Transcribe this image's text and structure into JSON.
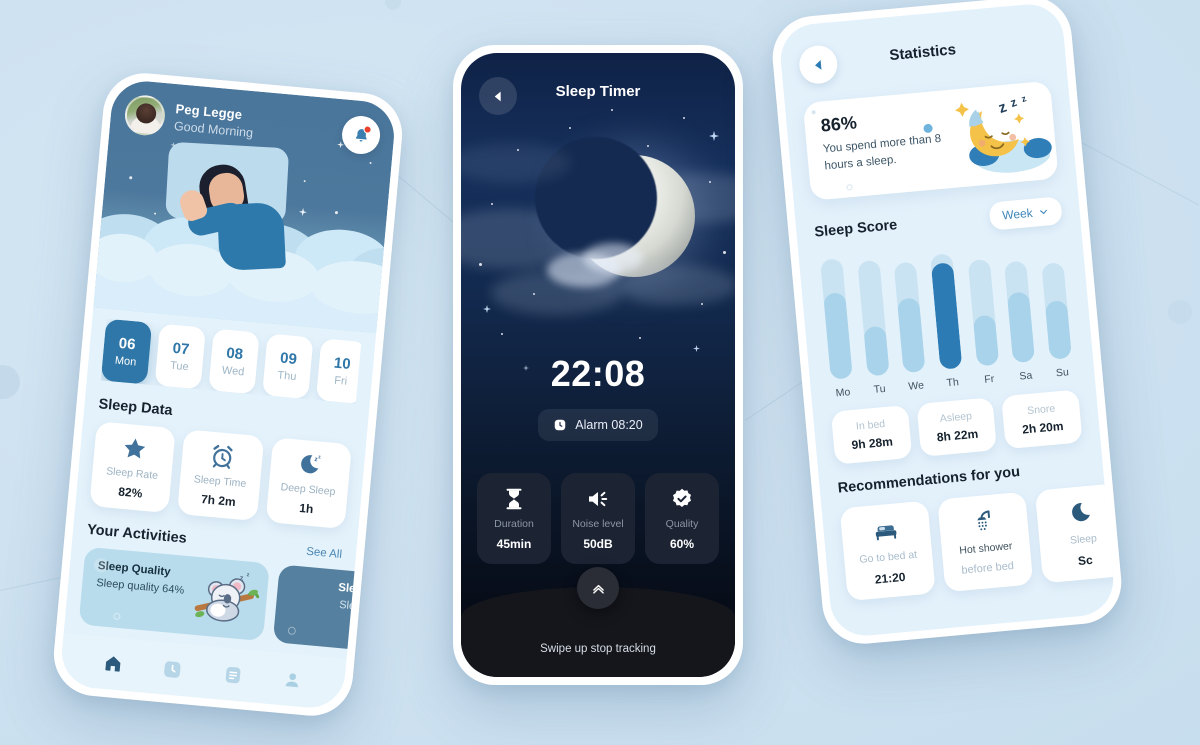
{
  "background": {
    "color": "#cfe2f1",
    "accent": "#2e77a8"
  },
  "phone_home": {
    "user_name": "Peg Legge",
    "greeting": "Good Morning",
    "bell_icon": "notification-bell-icon",
    "days": [
      {
        "num": "06",
        "day": "Mon",
        "active": true
      },
      {
        "num": "07",
        "day": "Tue",
        "active": false
      },
      {
        "num": "08",
        "day": "Wed",
        "active": false
      },
      {
        "num": "09",
        "day": "Thu",
        "active": false
      },
      {
        "num": "10",
        "day": "Fri",
        "active": false
      }
    ],
    "sleep_data_title": "Sleep Data",
    "sleep_data": [
      {
        "icon": "star-icon",
        "label": "Sleep Rate",
        "value": "82%"
      },
      {
        "icon": "alarm-clock-icon",
        "label": "Sleep Time",
        "value": "7h 2m"
      },
      {
        "icon": "moon-zzz-icon",
        "label": "Deep Sleep",
        "value": "1h"
      }
    ],
    "activities_title": "Your Activities",
    "see_all": "See All",
    "activities": [
      {
        "title": "Sleep Quality",
        "subtitle": "Sleep quality 64%",
        "dark": false
      },
      {
        "title": "Sleep",
        "subtitle": "Sleep",
        "dark": true
      }
    ],
    "nav": [
      {
        "icon": "home-icon",
        "active": true
      },
      {
        "icon": "clock-icon",
        "active": false
      },
      {
        "icon": "document-icon",
        "active": false
      },
      {
        "icon": "person-icon",
        "active": false
      }
    ]
  },
  "phone_timer": {
    "back_icon": "back-arrow-icon",
    "title": "Sleep Timer",
    "time": "22:08",
    "alarm_icon": "clock-icon",
    "alarm_label": "Alarm 08:20",
    "metrics": [
      {
        "icon": "hourglass-icon",
        "label": "Duration",
        "value": "45min"
      },
      {
        "icon": "speaker-icon",
        "label": "Noise level",
        "value": "50dB"
      },
      {
        "icon": "badge-check-icon",
        "label": "Quality",
        "value": "60%"
      }
    ],
    "swipe_icon": "chevron-up-icon",
    "swipe_label": "Swipe up stop tracking"
  },
  "phone_stats": {
    "back_icon": "back-arrow-icon",
    "title": "Statistics",
    "hero": {
      "percent": "86%",
      "text": "You spend more than 8 hours a sleep.",
      "illustration": "sleeping-moon-icon"
    },
    "score_title": "Sleep Score",
    "range_label": "Week",
    "range_icon": "chevron-down-icon",
    "stats": [
      {
        "label": "In bed",
        "value": "9h 28m"
      },
      {
        "label": "Asleep",
        "value": "8h 22m"
      },
      {
        "label": "Snore",
        "value": "2h 20m"
      }
    ],
    "reco_title": "Recommendations for you",
    "recommendations": [
      {
        "icon": "bed-icon",
        "label": "Go to bed at",
        "value": "21:20"
      },
      {
        "icon": "shower-icon",
        "label": "Hot shower",
        "value": "before bed"
      },
      {
        "icon": "moon-icon",
        "label": "Sleep",
        "value": "Sc"
      }
    ]
  },
  "chart_data": {
    "type": "bar",
    "title": "Sleep Score",
    "categories": [
      "Mo",
      "Tu",
      "We",
      "Th",
      "Fr",
      "Sa",
      "Su"
    ],
    "values": [
      72,
      41,
      62,
      88,
      42,
      58,
      48
    ],
    "track_max": 100,
    "tracks": [
      100,
      96,
      92,
      96,
      88,
      84,
      80
    ],
    "highlight_index": 3,
    "xlabel": "",
    "ylabel": "",
    "ylim": [
      0,
      100
    ],
    "grid": false,
    "legend": false,
    "colors": {
      "track": "#c9e3f2",
      "fill": "#a9d3ea",
      "highlight": "#2d7bb5"
    }
  }
}
